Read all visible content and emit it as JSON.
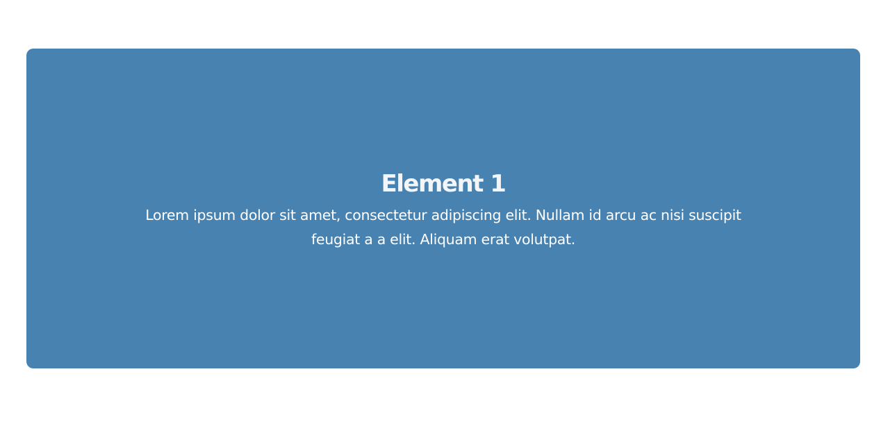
{
  "card": {
    "title": "Element 1",
    "body": "Lorem ipsum dolor sit amet, consectetur adipiscing elit. Nullam id arcu ac nisi suscipit feugiat a a elit. Aliquam erat volutpat."
  },
  "colors": {
    "page_background": "#ffffff",
    "card_background": "#4882b0",
    "title_text": "#f3f5f8",
    "body_text": "#ffffff"
  }
}
